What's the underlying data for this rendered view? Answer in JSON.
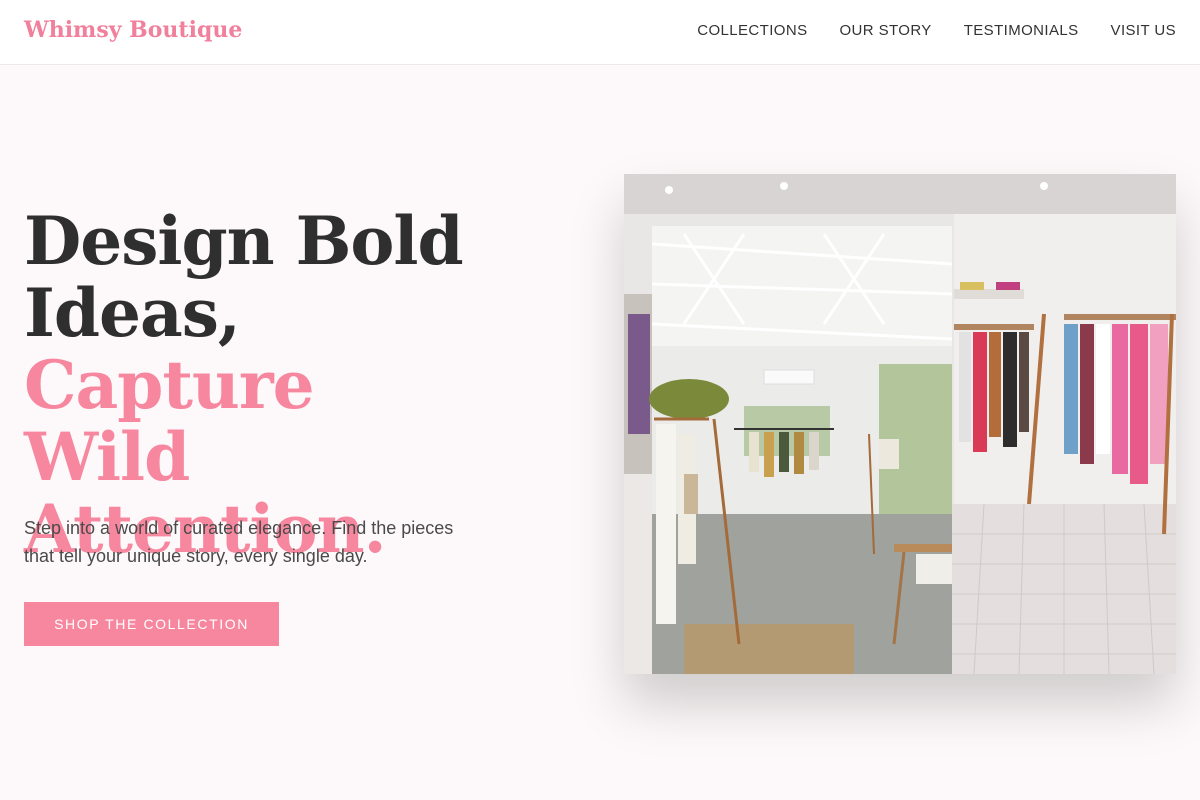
{
  "header": {
    "brand": "Whimsy Boutique",
    "nav": [
      "COLLECTIONS",
      "OUR STORY",
      "TESTIMONIALS",
      "VISIT US"
    ]
  },
  "hero": {
    "title_line1": "Design Bold",
    "title_line2": "Ideas,",
    "title_line3": "Capture Wild",
    "title_line4": "Attention.",
    "subtitle": "Step into a world of curated elegance. Find the pieces that tell your unique story, every single day.",
    "cta_label": "SHOP THE COLLECTION"
  },
  "colors": {
    "accent": "#f7879f",
    "text_dark": "#2f2f2f",
    "background": "#fdf9fa"
  }
}
